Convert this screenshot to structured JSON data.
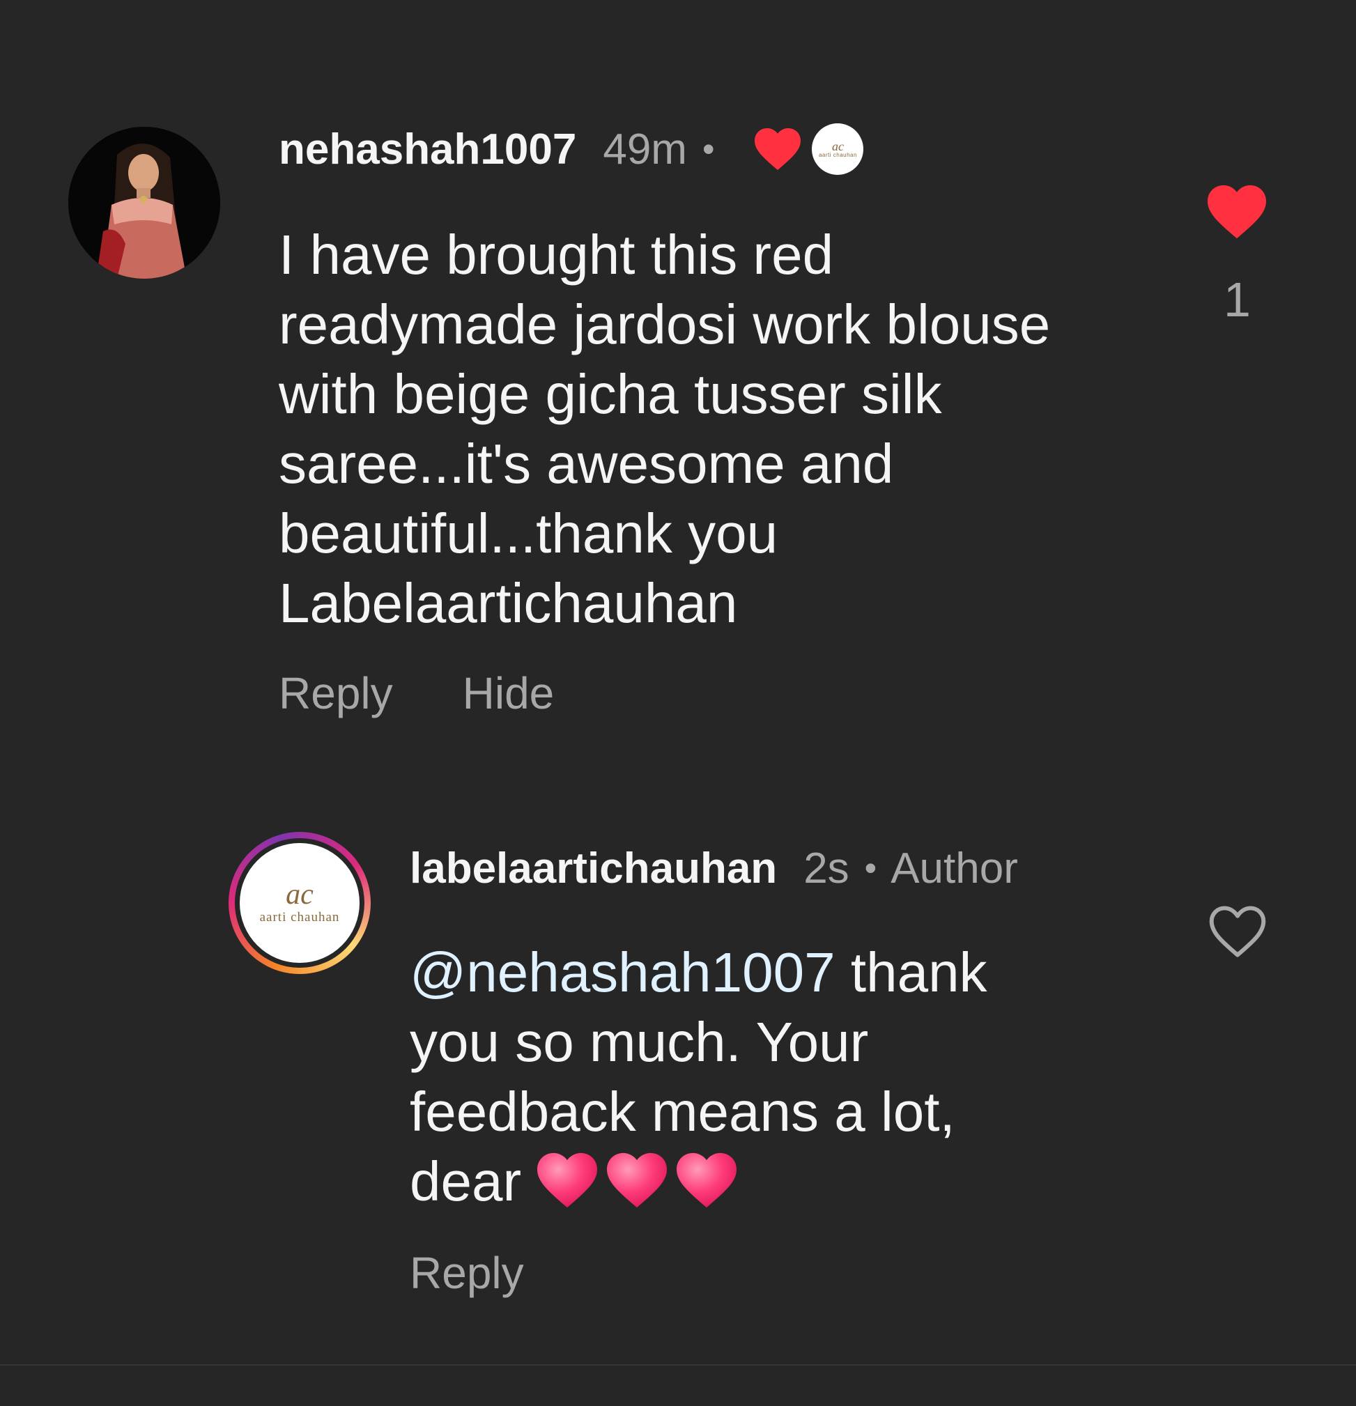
{
  "comments": [
    {
      "username": "nehashah1007",
      "time": "49m",
      "separator": "•",
      "body_lines": [
        "I have brought this red",
        "readymade jardosi work blouse",
        "with beige gicha tusser silk",
        "saree...it's awesome and",
        "beautiful...thank you",
        "Labelaartichauhan"
      ],
      "actions": {
        "reply": "Reply",
        "hide": "Hide"
      },
      "like_count": "1",
      "liked": true,
      "liked_by_creator": true
    },
    {
      "username": "labelaartichauhan",
      "time": "2s",
      "separator": "•",
      "badge": "Author",
      "mention": "@nehashah1007",
      "body_line1_rest": " thank",
      "body_lines": [
        "you so much. Your",
        "feedback means a lot,"
      ],
      "body_last": "dear",
      "emojis": [
        "pink-heart-emoji",
        "pink-heart-emoji",
        "pink-heart-emoji"
      ],
      "actions": {
        "reply": "Reply"
      },
      "liked": false
    }
  ],
  "brand_avatar": {
    "monogram": "ac",
    "wordmark": "aarti chauhan"
  },
  "colors": {
    "background": "#262626",
    "text": "#f5f5f5",
    "secondary": "#a8a8a8",
    "like_red": "#ff3040",
    "mention": "#e0f1ff"
  }
}
